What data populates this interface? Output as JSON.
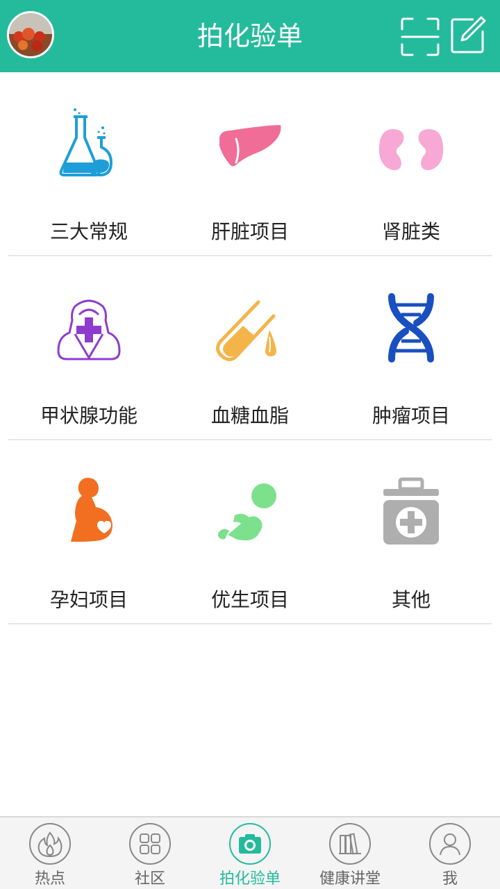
{
  "header": {
    "title": "拍化验单",
    "scan_icon": "scan-icon",
    "edit_icon": "edit-icon"
  },
  "categories": [
    {
      "label": "三大常规",
      "icon": "lab-flask-icon",
      "color": "#1e9ed8"
    },
    {
      "label": "肝脏项目",
      "icon": "liver-icon",
      "color": "#f06d98"
    },
    {
      "label": "肾脏类",
      "icon": "kidney-icon",
      "color": "#f7a8d4"
    },
    {
      "label": "甲状腺功能",
      "icon": "thyroid-nurse-icon",
      "color": "#8e3bd0"
    },
    {
      "label": "血糖血脂",
      "icon": "test-tube-drop-icon",
      "color": "#f3b54a"
    },
    {
      "label": "肿瘤项目",
      "icon": "dna-icon",
      "color": "#1a4fc2"
    },
    {
      "label": "孕妇项目",
      "icon": "pregnant-icon",
      "color": "#f26f21"
    },
    {
      "label": "优生项目",
      "icon": "baby-icon",
      "color": "#7de08c"
    },
    {
      "label": "其他",
      "icon": "medical-kit-icon",
      "color": "#aeaeae"
    }
  ],
  "tabs": [
    {
      "label": "热点",
      "icon": "flame-icon",
      "active": false
    },
    {
      "label": "社区",
      "icon": "grid-icon",
      "active": false
    },
    {
      "label": "拍化验单",
      "icon": "camera-icon",
      "active": true
    },
    {
      "label": "健康讲堂",
      "icon": "books-icon",
      "active": false
    },
    {
      "label": "我",
      "icon": "user-icon",
      "active": false
    }
  ],
  "colors": {
    "accent": "#24bb9c",
    "divider": "#e6e6e6",
    "tab_inactive": "#888888"
  }
}
